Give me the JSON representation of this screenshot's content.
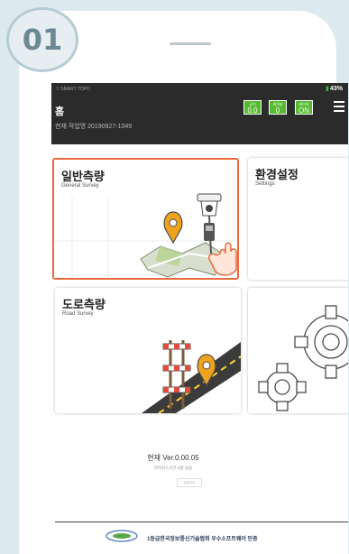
{
  "step": "01",
  "status_bar": {
    "brand": "SMART TOPO",
    "battery": "43%"
  },
  "header": {
    "title": "홈",
    "work": "현재 작업명 20190927-1049",
    "chips": [
      {
        "label": "공기",
        "value": "0.0"
      },
      {
        "label": "위치분",
        "value": "0"
      },
      {
        "label": "레이저",
        "value": "ON"
      }
    ]
  },
  "menu": {
    "general": {
      "title": "일반측량",
      "sub": "General Survey"
    },
    "settings": {
      "title": "환경설정",
      "sub": "Settings"
    },
    "road": {
      "title": "도로측량",
      "sub": "Road Survey"
    }
  },
  "footer": {
    "version": "현재 Ver.0.00.05",
    "license": "라이선스기간 3일 남음",
    "confirm": "업데이트",
    "cert": "1등급한국정보통신기술협회 우수소프트웨어 인증"
  },
  "colors": {
    "accent": "#ea6a3e",
    "chip": "#55b931",
    "header": "#2b2b2b",
    "pin": "#f0a31c"
  }
}
